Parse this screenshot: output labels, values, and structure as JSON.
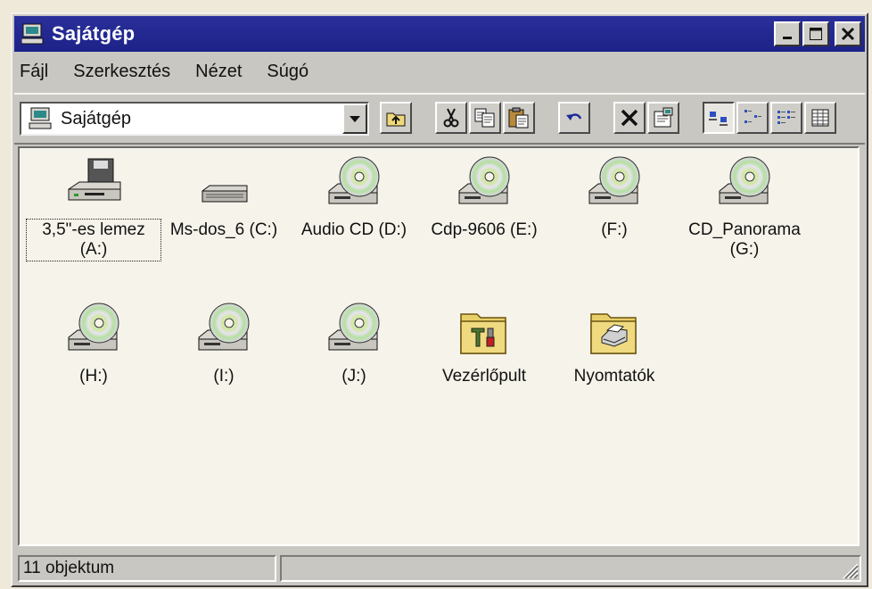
{
  "window": {
    "title": "Sajátgép"
  },
  "menu": [
    "Fájl",
    "Szerkesztés",
    "Nézet",
    "Súgó"
  ],
  "address": {
    "value": "Sajátgép"
  },
  "toolbar_icons": [
    "up-folder-icon",
    "cut-icon",
    "copy-icon",
    "paste-icon",
    "undo-icon",
    "delete-icon",
    "properties-icon",
    "large-icons-view-icon",
    "small-icons-view-icon",
    "list-view-icon",
    "details-view-icon"
  ],
  "items": [
    {
      "label": "3,5\"-es lemez (A:)",
      "icon": "floppy-drive-icon"
    },
    {
      "label": "Ms-dos_6 (C:)",
      "icon": "hard-drive-icon"
    },
    {
      "label": "Audio CD (D:)",
      "icon": "cd-drive-icon"
    },
    {
      "label": "Cdp-9606 (E:)",
      "icon": "cd-drive-icon"
    },
    {
      "label": "(F:)",
      "icon": "cd-drive-icon"
    },
    {
      "label": "CD_Panorama (G:)",
      "icon": "cd-drive-icon"
    },
    {
      "label": "(H:)",
      "icon": "cd-drive-icon"
    },
    {
      "label": "(I:)",
      "icon": "cd-drive-icon"
    },
    {
      "label": "(J:)",
      "icon": "cd-drive-icon"
    },
    {
      "label": "Vezérlőpult",
      "icon": "control-panel-folder-icon"
    },
    {
      "label": "Nyomtatók",
      "icon": "printers-folder-icon"
    }
  ],
  "status": {
    "text": "11 objektum"
  },
  "colors": {
    "titlebar": "#1d2288",
    "face": "#c9c7c2",
    "content_bg": "#f6f3ea"
  }
}
